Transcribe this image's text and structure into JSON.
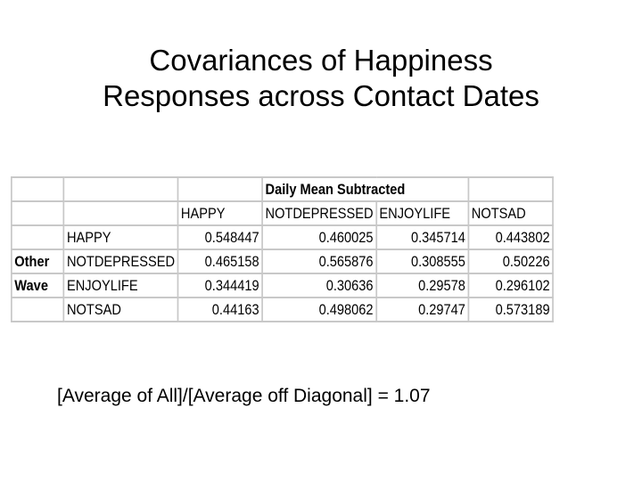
{
  "title": {
    "line1": "Covariances of Happiness",
    "line2": "Responses across Contact Dates"
  },
  "table": {
    "group_header": "Daily Mean Subtracted",
    "row_group_label": [
      "Other",
      "Wave"
    ],
    "columns": [
      "HAPPY",
      "NOTDEPRESSED",
      "ENJOYLIFE",
      "NOTSAD"
    ],
    "rows": [
      {
        "label": "HAPPY",
        "values": [
          "0.548447",
          "0.460025",
          "0.345714",
          "0.443802"
        ]
      },
      {
        "label": "NOTDEPRESSED",
        "values": [
          "0.465158",
          "0.565876",
          "0.308555",
          "0.50226"
        ]
      },
      {
        "label": "ENJOYLIFE",
        "values": [
          "0.344419",
          "0.30636",
          "0.29578",
          "0.296102"
        ]
      },
      {
        "label": "NOTSAD",
        "values": [
          "0.44163",
          "0.498062",
          "0.29747",
          "0.573189"
        ]
      }
    ]
  },
  "footer": "[Average of All]/[Average off Diagonal] = 1.07"
}
